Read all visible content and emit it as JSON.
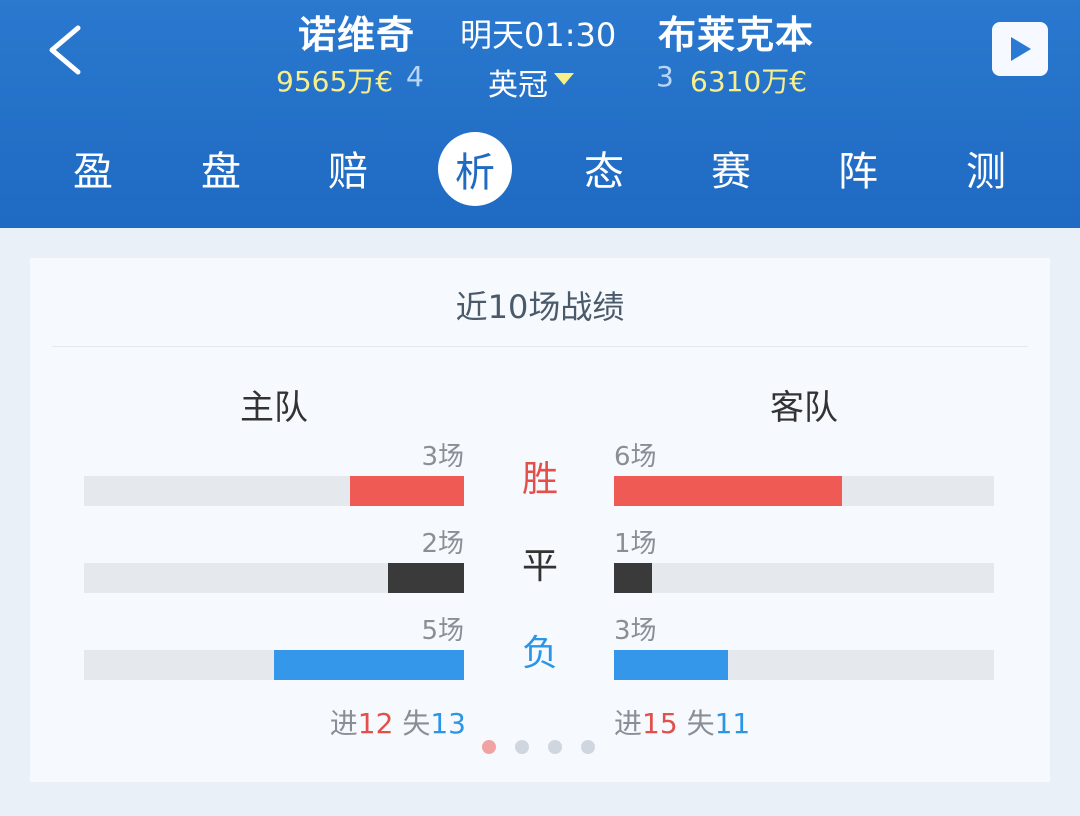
{
  "header": {
    "home_team": "诺维奇",
    "match_time": "明天01:30",
    "away_team": "布莱克本",
    "home_value": "9565万€",
    "home_rank": "4",
    "league": "英冠",
    "away_rank": "3",
    "away_value": "6310万€"
  },
  "tabs": [
    "盈",
    "盘",
    "赔",
    "析",
    "态",
    "赛",
    "阵",
    "测"
  ],
  "active_tab": "析",
  "card": {
    "title": "近10场战绩",
    "home_label": "主队",
    "away_label": "客队",
    "rows": [
      {
        "label": "胜",
        "home": "3场",
        "away": "6场",
        "home_n": 3,
        "away_n": 6,
        "color": "#f05a55",
        "label_color": "#e3504c"
      },
      {
        "label": "平",
        "home": "2场",
        "away": "1场",
        "home_n": 2,
        "away_n": 1,
        "color": "#3a3a3a",
        "label_color": "#333333"
      },
      {
        "label": "负",
        "home": "5场",
        "away": "3场",
        "home_n": 5,
        "away_n": 3,
        "color": "#3597ea",
        "label_color": "#2b96e6"
      }
    ],
    "home_goals": {
      "for_label": "进",
      "for": "12",
      "against_label": "失",
      "against": "13"
    },
    "away_goals": {
      "for_label": "进",
      "for": "15",
      "against_label": "失",
      "against": "11"
    }
  },
  "pagination": {
    "count": 4,
    "active": 0,
    "active_color": "#f1a3a3"
  }
}
